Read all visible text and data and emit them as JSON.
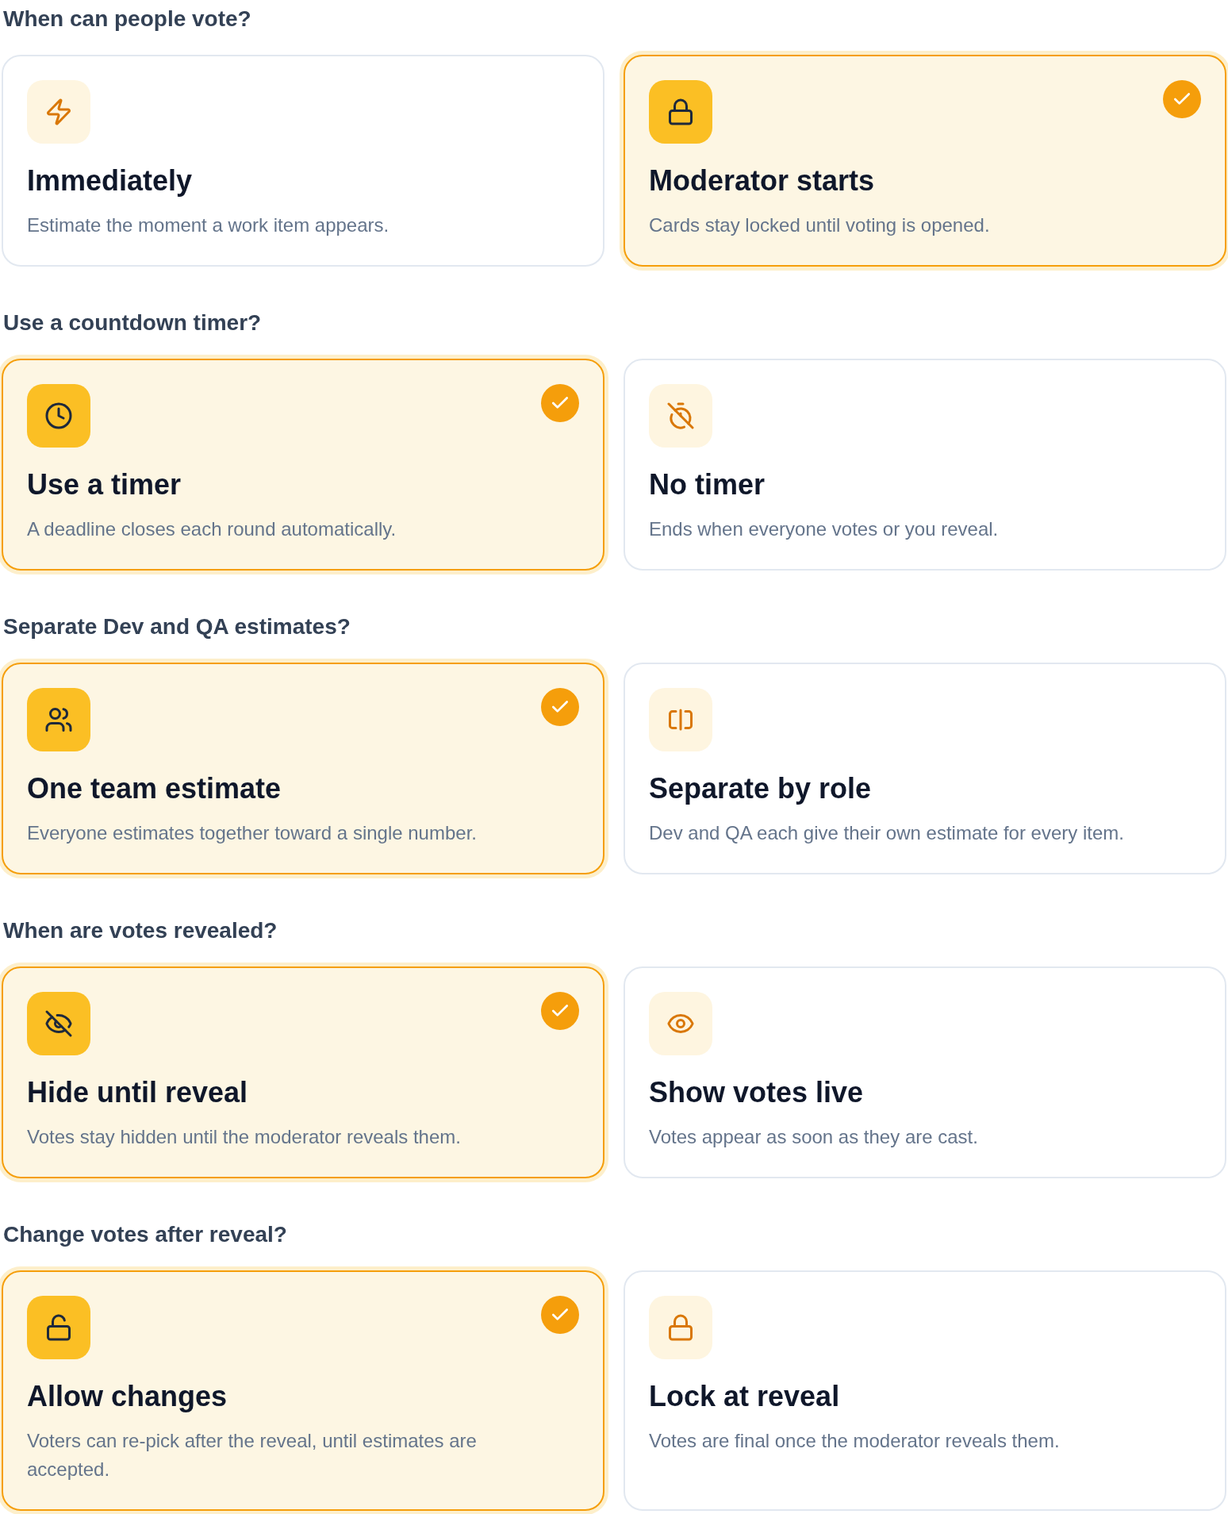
{
  "sections": [
    {
      "heading": "When can people vote?",
      "options": [
        {
          "title": "Immediately",
          "description": "Estimate the moment a work item appears.",
          "selected": false
        },
        {
          "title": "Moderator starts",
          "description": "Cards stay locked until voting is opened.",
          "selected": true
        }
      ]
    },
    {
      "heading": "Use a countdown timer?",
      "options": [
        {
          "title": "Use a timer",
          "description": "A deadline closes each round automatically.",
          "selected": true
        },
        {
          "title": "No timer",
          "description": "Ends when everyone votes or you reveal.",
          "selected": false
        }
      ]
    },
    {
      "heading": "Separate Dev and QA estimates?",
      "options": [
        {
          "title": "One team estimate",
          "description": "Everyone estimates together toward a single number.",
          "selected": true
        },
        {
          "title": "Separate by role",
          "description": "Dev and QA each give their own estimate for every item.",
          "selected": false
        }
      ]
    },
    {
      "heading": "When are votes revealed?",
      "options": [
        {
          "title": "Hide until reveal",
          "description": "Votes stay hidden until the moderator reveals them.",
          "selected": true
        },
        {
          "title": "Show votes live",
          "description": "Votes appear as soon as they are cast.",
          "selected": false
        }
      ]
    },
    {
      "heading": "Change votes after reveal?",
      "options": [
        {
          "title": "Allow changes",
          "description": "Voters can re-pick after the reveal, until estimates are accepted.",
          "selected": true
        },
        {
          "title": "Lock at reveal",
          "description": "Votes are final once the moderator reveals them.",
          "selected": false
        }
      ]
    }
  ]
}
